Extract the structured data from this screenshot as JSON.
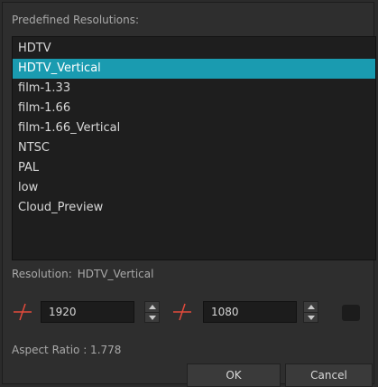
{
  "dialog": {
    "predefined_label": "Predefined Resolutions:",
    "resolutions": [
      "HDTV",
      "HDTV_Vertical",
      "film-1.33",
      "film-1.66",
      "film-1.66_Vertical",
      "NTSC",
      "PAL",
      "low",
      "Cloud_Preview"
    ],
    "selected_index": 1,
    "resolution_label": "Resolution:",
    "resolution_value": "HDTV_Vertical",
    "width_value": "1920",
    "height_value": "1080",
    "aspect_ratio_text": "Aspect Ratio : 1.778",
    "ok_label": "OK",
    "cancel_label": "Cancel"
  },
  "colors": {
    "selection": "#1a9bb0",
    "axis_icon": "#e24a3b"
  },
  "icons": {
    "width_axis": "axis-x-icon",
    "height_axis": "axis-y-icon",
    "lock": "lock-ratio-icon"
  }
}
